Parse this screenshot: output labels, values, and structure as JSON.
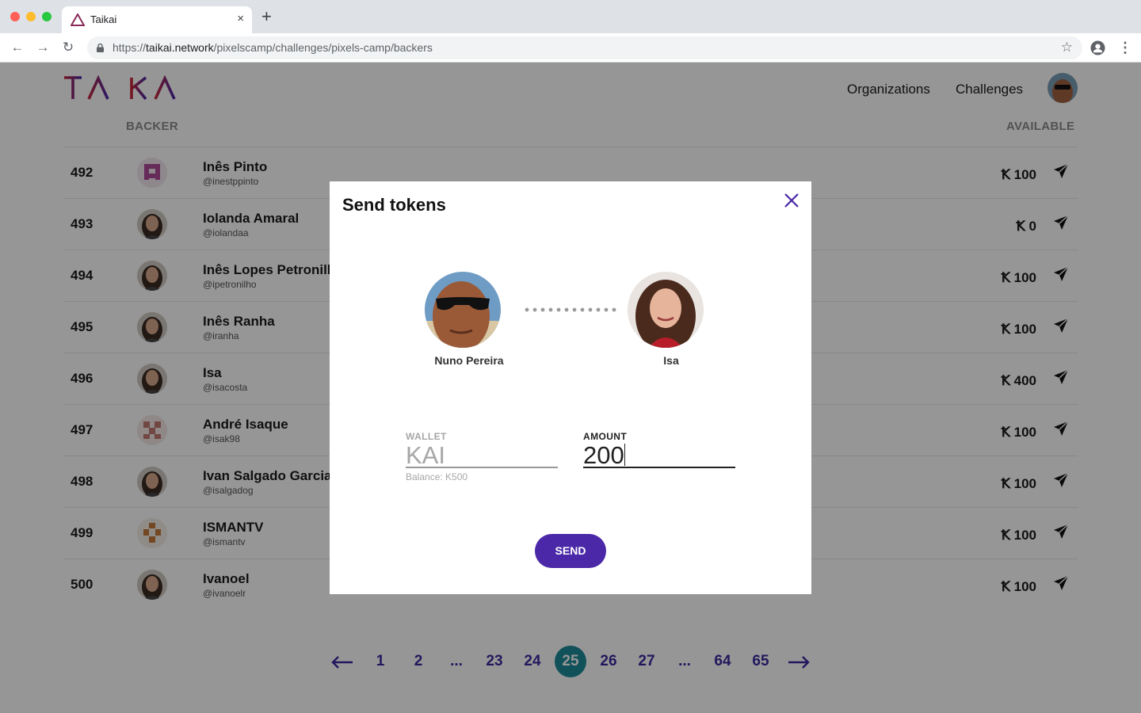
{
  "browser": {
    "tab_title": "Taikai",
    "tab_close": "×",
    "new_tab": "+",
    "url_scheme": "https://",
    "url_host": "taikai.network",
    "url_path": "/pixelscamp/challenges/pixels-camp/backers",
    "nav_back": "←",
    "nav_forward": "→",
    "nav_reload": "↻",
    "star": "☆",
    "menu": "⋮"
  },
  "header": {
    "logo_text": "TAIKAI",
    "nav": [
      "Organizations",
      "Challenges"
    ]
  },
  "table": {
    "col_backer": "BACKER",
    "col_available": "AVAILABLE",
    "currency_symbol": "Ꝁ",
    "rows": [
      {
        "rank": "492",
        "name": "Inês Pinto",
        "handle": "@inestppinto",
        "amount": "100",
        "avatar": "pixel-pink-avatar"
      },
      {
        "rank": "493",
        "name": "Iolanda Amaral",
        "handle": "@iolandaa",
        "amount": "0",
        "avatar": "photo-avatar"
      },
      {
        "rank": "494",
        "name": "Inês Lopes Petronilho",
        "handle": "@ipetronilho",
        "amount": "100",
        "avatar": "photo-avatar"
      },
      {
        "rank": "495",
        "name": "Inês Ranha",
        "handle": "@iranha",
        "amount": "100",
        "avatar": "photo-avatar"
      },
      {
        "rank": "496",
        "name": "Isa",
        "handle": "@isacosta",
        "amount": "400",
        "avatar": "photo-avatar"
      },
      {
        "rank": "497",
        "name": "André Isaque",
        "handle": "@isak98",
        "amount": "100",
        "avatar": "pixel-red-avatar"
      },
      {
        "rank": "498",
        "name": "Ivan Salgado Garcia",
        "handle": "@isalgadog",
        "amount": "100",
        "avatar": "photo-avatar"
      },
      {
        "rank": "499",
        "name": "ISMANTV",
        "handle": "@ismantv",
        "amount": "100",
        "avatar": "pixel-orange-avatar"
      },
      {
        "rank": "500",
        "name": "Ivanoel",
        "handle": "@ivanoelr",
        "amount": "100",
        "avatar": "photo-avatar"
      }
    ]
  },
  "pagination": {
    "pages": [
      "1",
      "2",
      "...",
      "23",
      "24",
      "25",
      "26",
      "27",
      "...",
      "64",
      "65"
    ],
    "current": "25"
  },
  "modal": {
    "title": "Send tokens",
    "from_name": "Nuno Pereira",
    "to_name": "Isa",
    "wallet_label": "WALLET",
    "wallet_value": "KAI",
    "balance": "Balance: K500",
    "amount_label": "AMOUNT",
    "amount_value": "200",
    "send_label": "SEND"
  },
  "colors": {
    "brand_purple": "#4a28a8",
    "brand_red": "#c8283c",
    "current_page": "#1e8a9a",
    "pager_text": "#3a2aa0"
  }
}
